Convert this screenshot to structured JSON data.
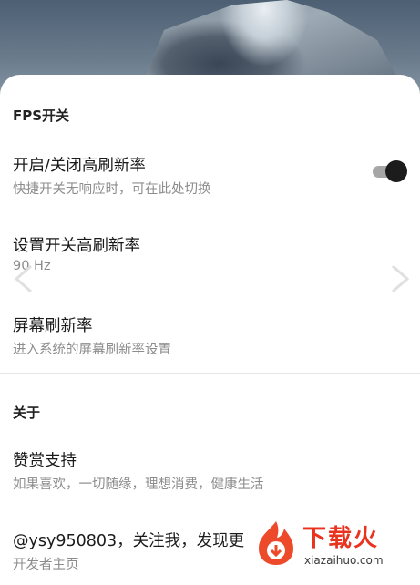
{
  "sections": [
    {
      "title": "FPS开关",
      "items": [
        {
          "title": "开启/关闭高刷新率",
          "subtitle": "快捷开关无响应时，可在此处切换",
          "toggle_on": true
        },
        {
          "title": "设置开关高刷新率",
          "subtitle": "90 Hz"
        },
        {
          "title": "屏幕刷新率",
          "subtitle": "进入系统的屏幕刷新率设置"
        }
      ]
    },
    {
      "title": "关于",
      "items": [
        {
          "title": "赞赏支持",
          "subtitle": "如果喜欢，一切随缘，理想消费，健康生活"
        },
        {
          "title": "@ysy950803，关注我，发现更",
          "subtitle": "开发者主页"
        }
      ]
    }
  ],
  "watermark": {
    "brand": "下载火",
    "url": "xiazaihuo.com",
    "color": "#e9331f"
  },
  "icons": [
    "toggle-switch",
    "chevron-left-icon",
    "chevron-right-icon",
    "flame-logo-icon"
  ]
}
